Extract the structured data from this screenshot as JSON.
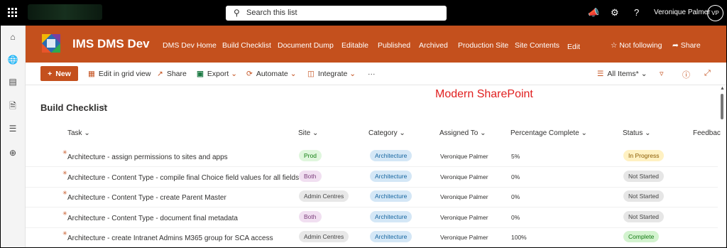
{
  "suite": {
    "search_placeholder": "Search this list",
    "user_name": "Veronique Palmer",
    "user_initials": "VP"
  },
  "site": {
    "title": "IMS DMS Dev",
    "nav": [
      "DMS Dev Home",
      "Build Checklist",
      "Document Dump",
      "Editable",
      "Published",
      "Archived",
      "Production Site",
      "Site Contents",
      "Edit"
    ],
    "follow_label": "Not following",
    "share_label": "Share",
    "brand_color": "#c4501d"
  },
  "commands": {
    "new": "New",
    "grid": "Edit in grid view",
    "share": "Share",
    "export": "Export",
    "automate": "Automate",
    "integrate": "Integrate",
    "more": "···",
    "view": "All Items*"
  },
  "annotation": "Modern SharePoint",
  "list": {
    "title": "Build Checklist",
    "columns": [
      "Task",
      "Site",
      "Category",
      "Assigned To",
      "Percentage Complete",
      "Status",
      "Feedbac"
    ],
    "rows": [
      {
        "task": "Architecture - assign permissions to sites and apps",
        "site": "Prod",
        "category": "Architecture",
        "assigned": "Veronique Palmer",
        "percent": "5%",
        "status": "In Progress"
      },
      {
        "task": "Architecture - Content Type - compile final Choice field values for all fields",
        "site": "Both",
        "category": "Architecture",
        "assigned": "Veronique Palmer",
        "percent": "0%",
        "status": "Not Started"
      },
      {
        "task": "Architecture - Content Type - create Parent Master",
        "site": "Admin Centres",
        "category": "Architecture",
        "assigned": "Veronique Palmer",
        "percent": "0%",
        "status": "Not Started"
      },
      {
        "task": "Architecture - Content Type - document final metadata",
        "site": "Both",
        "category": "Architecture",
        "assigned": "Veronique Palmer",
        "percent": "0%",
        "status": "Not Started"
      },
      {
        "task": "Architecture - create Intranet Admins M365 group for SCA access",
        "site": "Admin Centres",
        "category": "Architecture",
        "assigned": "Veronique Palmer",
        "percent": "100%",
        "status": "Complete"
      }
    ]
  },
  "pill_colors": {
    "Prod": [
      "#dff6dd",
      "#107c10"
    ],
    "Both": [
      "#f1dff1",
      "#7a3d7a"
    ],
    "Admin Centres": [
      "#e8e8e8",
      "#444444"
    ],
    "Architecture": [
      "#d4e7f6",
      "#1565a0"
    ],
    "In Progress": [
      "#fff1c2",
      "#8a5a00"
    ],
    "Not Started": [
      "#e6e6e6",
      "#444444"
    ],
    "Complete": [
      "#d3f3cf",
      "#137a13"
    ]
  }
}
